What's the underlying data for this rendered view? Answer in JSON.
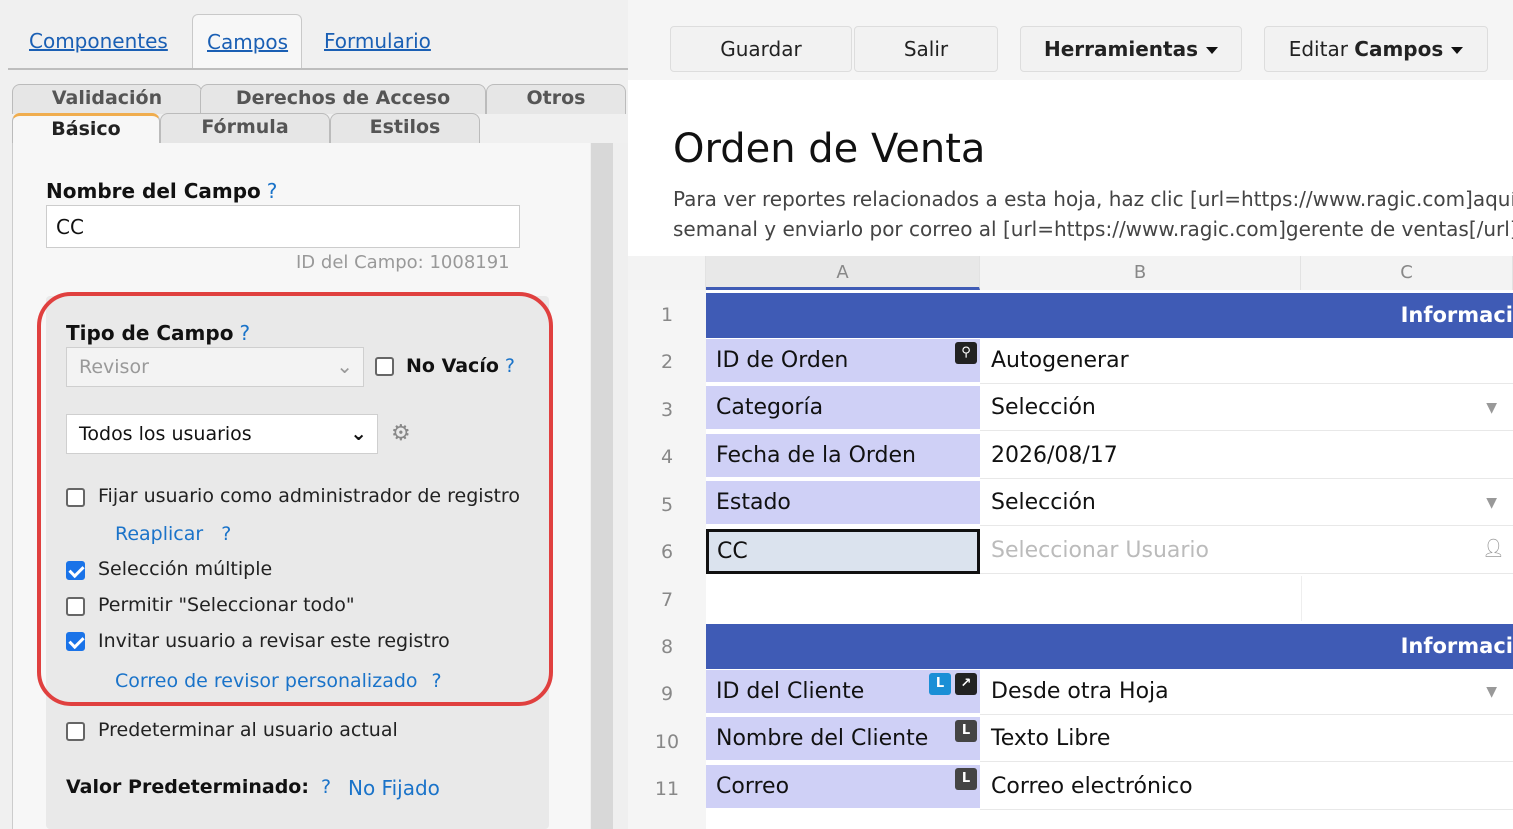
{
  "left": {
    "top_tabs": [
      "Componentes",
      "Campos",
      "Formulario"
    ],
    "sub_tabs_row1": [
      "Validación",
      "Derechos de Acceso",
      "Otros"
    ],
    "sub_tabs_row2": [
      "Básico",
      "Fórmula",
      "Estilos"
    ],
    "field_name_label": "Nombre del Campo",
    "help_mark": "?",
    "field_name_value": "CC",
    "field_id": "ID del Campo: 1008191",
    "field_type_label": "Tipo de Campo",
    "field_type_value": "Revisor",
    "no_empty_label": "No Vacío",
    "no_empty_checked": false,
    "users_select": "Todos los usuarios",
    "options": [
      {
        "label": "Fijar usuario como administrador de registro",
        "checked": false
      },
      {
        "label": "Selección múltiple",
        "checked": true
      },
      {
        "label": "Permitir \"Seleccionar todo\"",
        "checked": false
      },
      {
        "label": "Invitar usuario a revisar este registro",
        "checked": true
      },
      {
        "label": "Predeterminar al usuario actual",
        "checked": false
      }
    ],
    "reapply_link": "Reaplicar",
    "custom_mail_link": "Correo de revisor personalizado",
    "default_value_label": "Valor Predeterminado:",
    "default_value": "No Fijado",
    "highlight_color": "#e0403f"
  },
  "toolbar": {
    "save": "Guardar",
    "exit": "Salir",
    "tools": "Herramientas",
    "edit_prefix": "Editar",
    "edit_bold": "Campos"
  },
  "sheet": {
    "title": "Orden de Venta",
    "desc_line1": "Para ver reportes relacionados a esta hoja, haz clic [url=https://www.ragic.com]aquí",
    "desc_line2": "semanal y enviarlo por correo al [url=https://www.ragic.com]gerente de ventas[/url]",
    "columns": [
      "A",
      "B",
      "C"
    ],
    "rownums": [
      "1",
      "2",
      "3",
      "4",
      "5",
      "6",
      "7",
      "8",
      "9",
      "10",
      "11"
    ],
    "band1": "Informaci",
    "band2": "Informaci",
    "rows": [
      {
        "label": "ID de Orden",
        "value": "Autogenerar"
      },
      {
        "label": "Categoría",
        "value": "Selección"
      },
      {
        "label": "Fecha de la Orden",
        "value": "2026/08/17"
      },
      {
        "label": "Estado",
        "value": "Selección"
      },
      {
        "label": "CC",
        "value": "Seleccionar Usuario"
      },
      {
        "label": "ID del Cliente",
        "value": "Desde otra Hoja"
      },
      {
        "label": "Nombre del Cliente",
        "value": "Texto Libre"
      },
      {
        "label": "Correo",
        "value": "Correo electrónico"
      }
    ],
    "badge_L": "L",
    "header_color": "#3f5bb5",
    "label_color": "#cfd0f6"
  }
}
